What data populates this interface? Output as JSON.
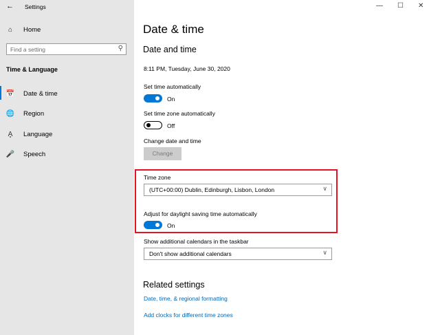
{
  "window": {
    "title": "Settings",
    "back_icon": "arrow-left-icon",
    "controls": [
      "minimize",
      "maximize",
      "close"
    ]
  },
  "sidebar": {
    "home": "Home",
    "search_placeholder": "Find a setting",
    "section": "Time & Language",
    "items": [
      {
        "label": "Date & time",
        "icon": "calendar-clock-icon",
        "selected": true
      },
      {
        "label": "Region",
        "icon": "globe-icon"
      },
      {
        "label": "Language",
        "icon": "language-icon"
      },
      {
        "label": "Speech",
        "icon": "microphone-icon"
      }
    ]
  },
  "main": {
    "page_title": "Date & time",
    "section_title": "Date and time",
    "current_datetime": "8:11 PM, Tuesday, June 30, 2020",
    "set_time_auto": {
      "label": "Set time automatically",
      "state": "On"
    },
    "set_tz_auto": {
      "label": "Set time zone automatically",
      "state": "Off"
    },
    "change": {
      "label": "Change date and time",
      "button": "Change"
    },
    "time_zone": {
      "label": "Time zone",
      "value": "(UTC+00:00) Dublin, Edinburgh, Lisbon, London"
    },
    "dst": {
      "label": "Adjust for daylight saving time automatically",
      "state": "On"
    },
    "calendars": {
      "label": "Show additional calendars in the taskbar",
      "value": "Don't show additional calendars"
    },
    "related": {
      "title": "Related settings",
      "links": [
        "Date, time, & regional formatting",
        "Add clocks for different time zones"
      ]
    }
  },
  "colors": {
    "accent": "#0078d7",
    "highlight": "#e81123",
    "link": "#0067b8"
  }
}
